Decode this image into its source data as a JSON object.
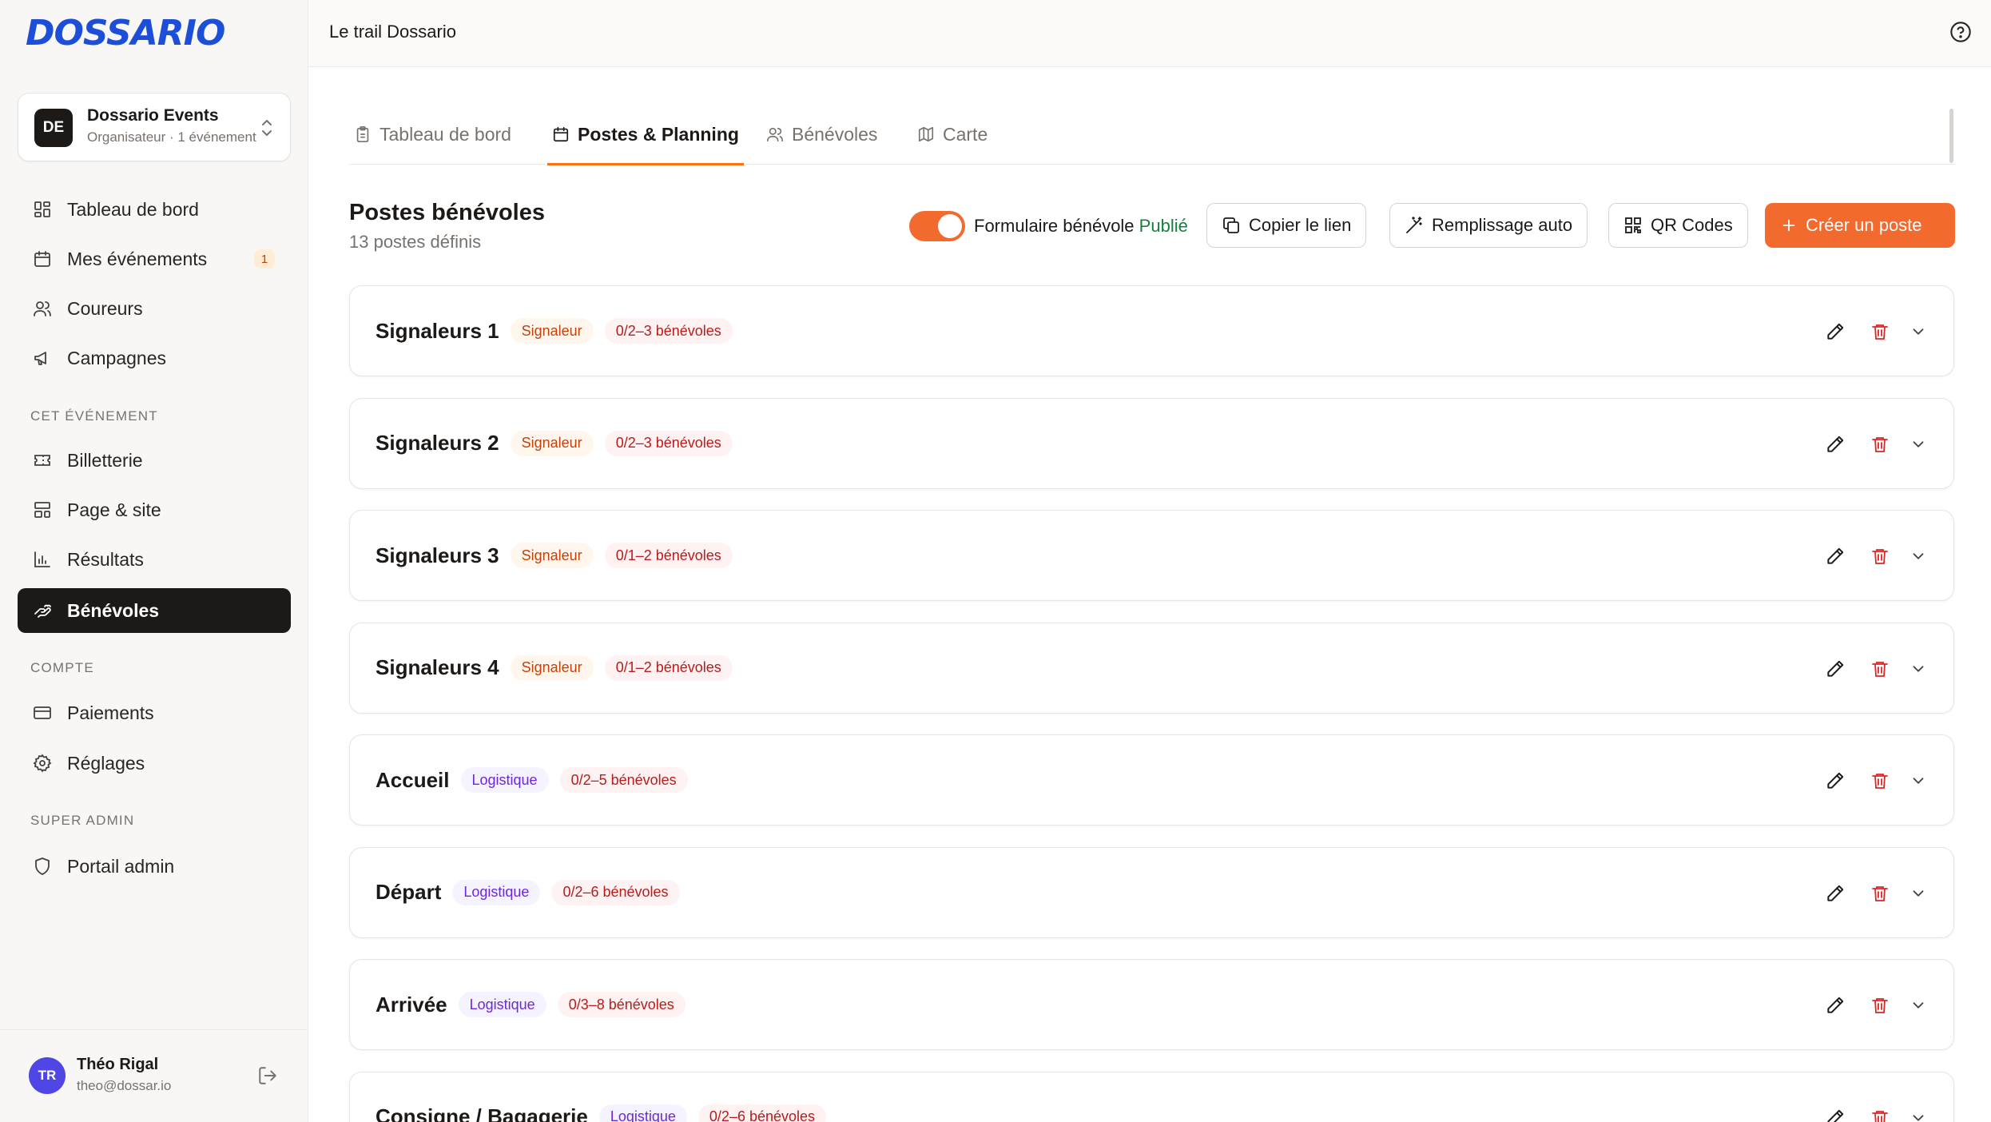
{
  "brand": {
    "logo_text": "DOSSARIO",
    "accent": "#f26a2e",
    "primary_dark": "#1c1917"
  },
  "org": {
    "initials": "DE",
    "name": "Dossario Events",
    "subtitle": "Organisateur · 1 événement"
  },
  "nav": {
    "main": [
      {
        "label": "Tableau de bord",
        "icon": "dashboard-icon"
      },
      {
        "label": "Mes événements",
        "icon": "calendar-icon",
        "badge": "1"
      },
      {
        "label": "Coureurs",
        "icon": "users-icon"
      },
      {
        "label": "Campagnes",
        "icon": "megaphone-icon"
      }
    ],
    "section_event": "CET ÉVÉNEMENT",
    "event": [
      {
        "label": "Billetterie",
        "icon": "ticket-icon"
      },
      {
        "label": "Page & site",
        "icon": "layout-icon"
      },
      {
        "label": "Résultats",
        "icon": "bar-chart-icon"
      },
      {
        "label": "Bénévoles",
        "icon": "hand-heart-icon",
        "active": true
      }
    ],
    "section_account": "COMPTE",
    "account": [
      {
        "label": "Paiements",
        "icon": "credit-card-icon"
      },
      {
        "label": "Réglages",
        "icon": "gear-icon"
      }
    ],
    "section_admin": "SUPER ADMIN",
    "admin": [
      {
        "label": "Portail admin",
        "icon": "shield-icon"
      }
    ]
  },
  "user": {
    "initials": "TR",
    "name": "Théo Rigal",
    "email": "theo@dossar.io"
  },
  "header": {
    "title": "Le trail Dossario"
  },
  "tabs": [
    {
      "label": "Tableau de bord",
      "icon": "clipboard-icon"
    },
    {
      "label": "Postes & Planning",
      "icon": "calendar-icon",
      "active": true
    },
    {
      "label": "Bénévoles",
      "icon": "users-icon"
    },
    {
      "label": "Carte",
      "icon": "map-icon"
    }
  ],
  "section": {
    "title": "Postes bénévoles",
    "count": "13 postes définis"
  },
  "form_toggle": {
    "label": "Formulaire bénévole",
    "status": "Publié",
    "enabled": true
  },
  "actions": {
    "copy_link": "Copier le lien",
    "auto_fill": "Remplissage auto",
    "qr_codes": "QR Codes",
    "create": "Créer un poste"
  },
  "posts": [
    {
      "name": "Signaleurs 1",
      "category": "Signaleur",
      "volunteers": "0/2–3 bénévoles"
    },
    {
      "name": "Signaleurs 2",
      "category": "Signaleur",
      "volunteers": "0/2–3 bénévoles"
    },
    {
      "name": "Signaleurs 3",
      "category": "Signaleur",
      "volunteers": "0/1–2 bénévoles"
    },
    {
      "name": "Signaleurs 4",
      "category": "Signaleur",
      "volunteers": "0/1–2 bénévoles"
    },
    {
      "name": "Accueil",
      "category": "Logistique",
      "volunteers": "0/2–5 bénévoles"
    },
    {
      "name": "Départ",
      "category": "Logistique",
      "volunteers": "0/2–6 bénévoles"
    },
    {
      "name": "Arrivée",
      "category": "Logistique",
      "volunteers": "0/3–8 bénévoles"
    },
    {
      "name": "Consigne / Bagagerie",
      "category": "Logistique",
      "volunteers": "0/2–6 bénévoles"
    }
  ]
}
